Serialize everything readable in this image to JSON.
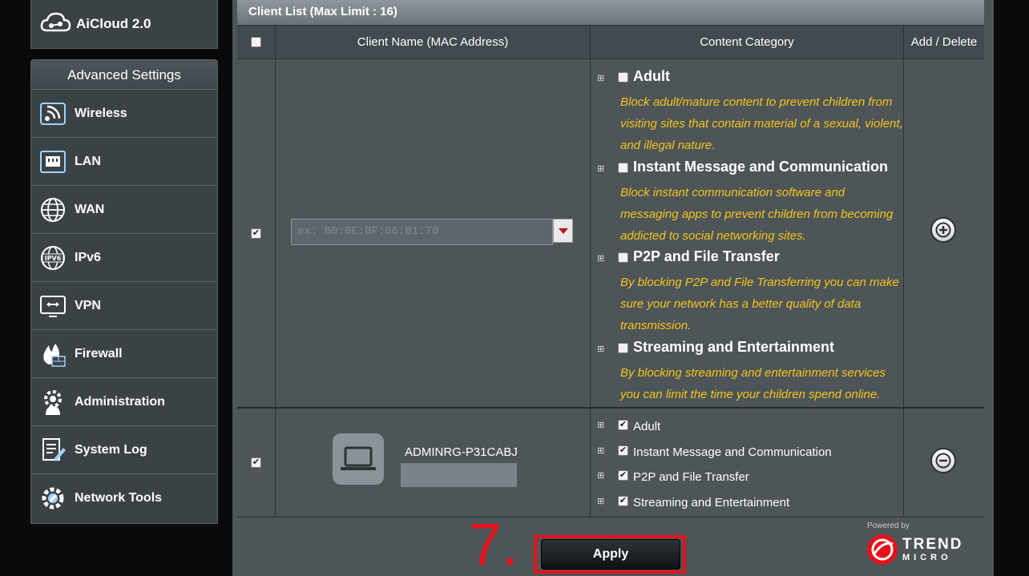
{
  "sidebar": {
    "aicloud_label": "AiCloud 2.0",
    "advanced_title": "Advanced Settings",
    "items": [
      {
        "label": "Wireless",
        "icon": "wireless-icon"
      },
      {
        "label": "LAN",
        "icon": "lan-icon"
      },
      {
        "label": "WAN",
        "icon": "wan-icon"
      },
      {
        "label": "IPv6",
        "icon": "ipv6-icon"
      },
      {
        "label": "VPN",
        "icon": "vpn-icon"
      },
      {
        "label": "Firewall",
        "icon": "firewall-icon"
      },
      {
        "label": "Administration",
        "icon": "administration-icon"
      },
      {
        "label": "System Log",
        "icon": "system-log-icon"
      },
      {
        "label": "Network Tools",
        "icon": "network-tools-icon"
      }
    ]
  },
  "client_list": {
    "title": "Client List (Max Limit : 16)",
    "columns": {
      "client": "Client Name (MAC Address)",
      "category": "Content Category",
      "action": "Add / Delete"
    },
    "new_row": {
      "mac_placeholder": "ex: B0:6E:BF:66:B1:70",
      "categories": [
        {
          "title": "Adult",
          "desc": "Block adult/mature content to prevent children from visiting sites that contain material of a sexual, violent, and illegal nature."
        },
        {
          "title": "Instant Message and Communication",
          "desc": "Block instant communication software and messaging apps to prevent children from becoming addicted to social networking sites."
        },
        {
          "title": "P2P and File Transfer",
          "desc": "By blocking P2P and File Transferring you can make sure your network has a better quality of data transmission."
        },
        {
          "title": "Streaming and Entertainment",
          "desc": "By blocking streaming and entertainment services you can limit the time your children spend online."
        }
      ]
    },
    "client_row": {
      "name": "ADMINRG-P31CABJ",
      "categories": [
        "Adult",
        "Instant Message and Communication",
        "P2P and File Transfer",
        "Streaming and Entertainment"
      ]
    }
  },
  "footer": {
    "step": "7.",
    "apply_label": "Apply",
    "powered_by": "Powered by",
    "brand_line1": "TREND",
    "brand_line2": "MICRO"
  },
  "colors": {
    "accent_red": "#e4121b",
    "desc_yellow": "#f5c518",
    "panel": "#4d5559"
  }
}
